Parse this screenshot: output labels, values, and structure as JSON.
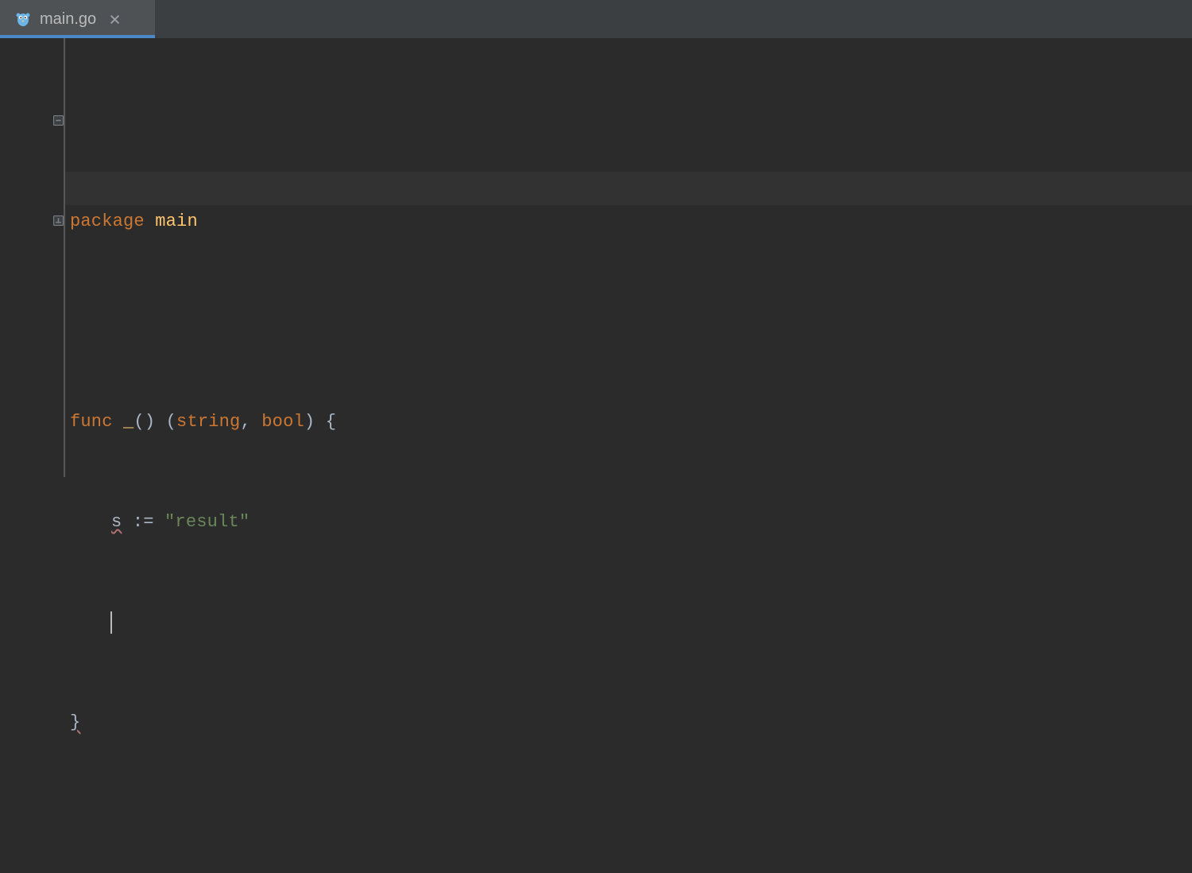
{
  "tab": {
    "filename": "main.go",
    "icon": "go-gopher-icon",
    "active": true
  },
  "code": {
    "lines": [
      {
        "type": "pkg",
        "keyword": "package",
        "name": "main"
      },
      {
        "type": "blank"
      },
      {
        "type": "func_decl",
        "keyword": "func",
        "name": "_",
        "ret_open": "(",
        "ret1": "string",
        "ret_comma": ", ",
        "ret2": "bool",
        "ret_close": ")",
        "brace": "{"
      },
      {
        "type": "assign",
        "var": "s",
        "op": ":=",
        "value": "\"result\""
      },
      {
        "type": "caret"
      },
      {
        "type": "close_brace",
        "brace": "}"
      }
    ]
  },
  "colors": {
    "bg": "#2b2b2b",
    "tabbar": "#3c3f41",
    "tab_active": "#4e5254",
    "tab_underline": "#4a88c7",
    "keyword": "#cc7832",
    "identifier": "#ffc66d",
    "string": "#6a8759",
    "default": "#a9b7c6",
    "current_line": "#323232"
  }
}
